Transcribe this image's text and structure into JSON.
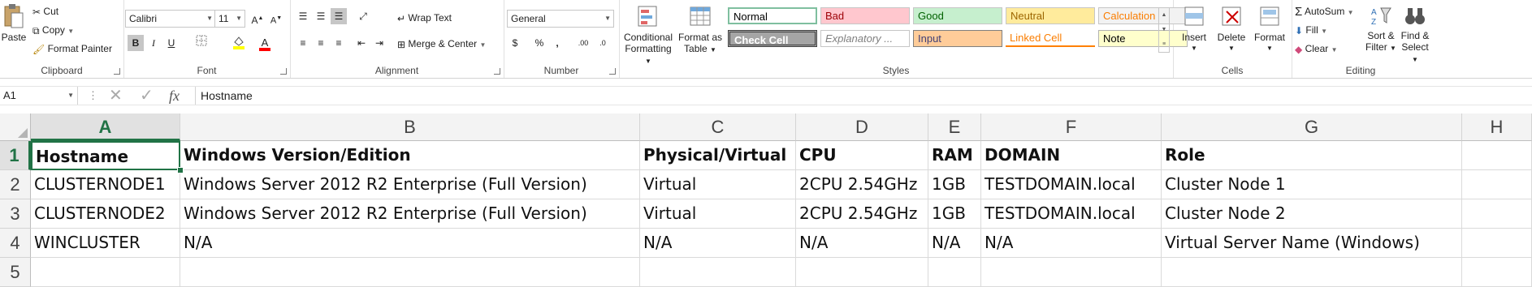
{
  "clipboard": {
    "paste": "Paste",
    "cut": "Cut",
    "copy": "Copy",
    "format_painter": "Format Painter",
    "label": "Clipboard"
  },
  "font": {
    "name": "Calibri",
    "size": "11",
    "label": "Font"
  },
  "alignment": {
    "wrap_text": "Wrap Text",
    "merge_center": "Merge & Center",
    "label": "Alignment"
  },
  "number": {
    "format": "General",
    "label": "Number"
  },
  "styles": {
    "conditional_formatting_1": "Conditional",
    "conditional_formatting_2": "Formatting",
    "format_as_table_1": "Format as",
    "format_as_table_2": "Table",
    "label": "Styles",
    "cells": [
      {
        "name": "Normal",
        "bg": "#ffffff",
        "fg": "#000000"
      },
      {
        "name": "Bad",
        "bg": "#ffc7ce",
        "fg": "#9c0006"
      },
      {
        "name": "Good",
        "bg": "#c6efce",
        "fg": "#006100"
      },
      {
        "name": "Neutral",
        "bg": "#ffeb9c",
        "fg": "#9c6500"
      },
      {
        "name": "Calculation",
        "bg": "#f2f2f2",
        "fg": "#fa7d00"
      },
      {
        "name": "Check Cell",
        "bg": "#a5a5a5",
        "fg": "#ffffff"
      },
      {
        "name": "Explanatory ...",
        "bg": "#ffffff",
        "fg": "#7f7f7f"
      },
      {
        "name": "Input",
        "bg": "#ffcc99",
        "fg": "#3f3f76"
      },
      {
        "name": "Linked Cell",
        "bg": "#ffffff",
        "fg": "#fa7d00"
      },
      {
        "name": "Note",
        "bg": "#ffffcc",
        "fg": "#000000"
      }
    ]
  },
  "cells_group": {
    "insert": "Insert",
    "delete": "Delete",
    "format": "Format",
    "label": "Cells"
  },
  "editing": {
    "autosum": "AutoSum",
    "fill": "Fill",
    "clear": "Clear",
    "sort_filter_1": "Sort &",
    "sort_filter_2": "Filter",
    "find_select_1": "Find &",
    "find_select_2": "Select",
    "label": "Editing"
  },
  "formula_bar": {
    "name_box": "A1",
    "fx": "fx",
    "content": "Hostname"
  },
  "sheet": {
    "columns": [
      "A",
      "B",
      "C",
      "D",
      "E",
      "F",
      "G",
      "H"
    ],
    "row_numbers": [
      "1",
      "2",
      "3",
      "4",
      "5"
    ],
    "rows": [
      [
        "Hostname",
        "Windows Version/Edition",
        "Physical/Virtual",
        "CPU",
        "RAM",
        "DOMAIN",
        "Role"
      ],
      [
        "CLUSTERNODE1",
        "Windows Server 2012 R2 Enterprise (Full Version)",
        "Virtual",
        "2CPU 2.54GHz",
        "1GB",
        "TESTDOMAIN.local",
        "Cluster Node 1"
      ],
      [
        "CLUSTERNODE2",
        "Windows Server 2012 R2 Enterprise (Full Version)",
        "Virtual",
        "2CPU 2.54GHz",
        "1GB",
        "TESTDOMAIN.local",
        "Cluster Node 2"
      ],
      [
        "WINCLUSTER",
        "N/A",
        "N/A",
        "N/A",
        "N/A",
        "N/A",
        "Virtual Server Name (Windows)"
      ]
    ]
  },
  "accent_color": "#217346"
}
